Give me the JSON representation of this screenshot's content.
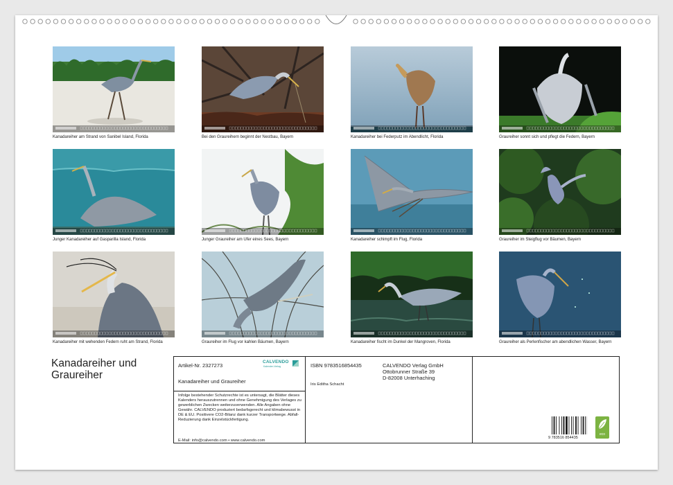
{
  "months": [
    {
      "caption": "Kanadareiher am Strand von Sanibel Island, Florida",
      "scene": "beach"
    },
    {
      "caption": "Bei den Graureihern beginnt der Nestbau, Bayern",
      "scene": "nest"
    },
    {
      "caption": "Kanadareiher bei Federputz im Abendlicht, Florida",
      "scene": "preen"
    },
    {
      "caption": "Graureiher sonnt sich und pflegt die Federn, Bayern",
      "scene": "sun"
    },
    {
      "caption": "Junger Kanadareiher auf Gasparilla Island, Florida",
      "scene": "sea"
    },
    {
      "caption": "Junger Graureiher am Ufer eines Sees, Bayern",
      "scene": "shore"
    },
    {
      "caption": "Kanadareiher schimpft im Flug, Florida",
      "scene": "flight"
    },
    {
      "caption": "Graureiher im Steigflug vor Bäumen, Bayern",
      "scene": "trees"
    },
    {
      "caption": "Kanadareiher mit wehenden Federn ruht am Strand, Florida",
      "scene": "portrait"
    },
    {
      "caption": "Graureiher im Flug vor kahlen Bäumen, Bayern",
      "scene": "branches"
    },
    {
      "caption": "Kanadareiher fischt im Dunkel der Mangroven, Florida",
      "scene": "mangrove"
    },
    {
      "caption": "Graureiher als Perlenfischer am abendlichen Wasser, Bayern",
      "scene": "evening"
    }
  ],
  "cover": {
    "title_line1": "Kanadareiher und",
    "title_line2": "Graureiher"
  },
  "info": {
    "article": "Artikel-Nr. 2327273",
    "brand": "CALVENDO",
    "brand_tagline": "Kalender-Verlag",
    "calendar_title": "Kanadareiher und Graureiher",
    "legal": "Infolge bestehender Schutzrechte ist es untersagt, die Blätter dieses Kalenders herauszutrennen und ohne Genehmigung des Verlages zu gewerblichen Zwecken weiterzuverwenden. Alle Angaben ohne Gewähr. CALVENDO produziert bedarfsgerecht und klimabewusst in DE & EU. Positivere CO2-Bilanz dank kurzer Transportwege. Abfall-Reduzierung dank Einzelstückfertigung.",
    "contact": "E-Mail: info@calvendo.com • www.calvendo.com",
    "isbn": "ISBN 9783516854435",
    "author": "Iris Editha Schacht",
    "publisher_name": "CALVENDO Verlag GmbH",
    "publisher_street": "Ottobrunner Straße 39",
    "publisher_city": "D-82008 Unterhaching",
    "barcode_digits": "9 783516 854435",
    "eco_label": "eco"
  },
  "colors": {
    "sheet": "#ffffff",
    "background": "#e9e9e9",
    "brand_teal": "#2a9d9a",
    "eco_green": "#7cb342"
  }
}
